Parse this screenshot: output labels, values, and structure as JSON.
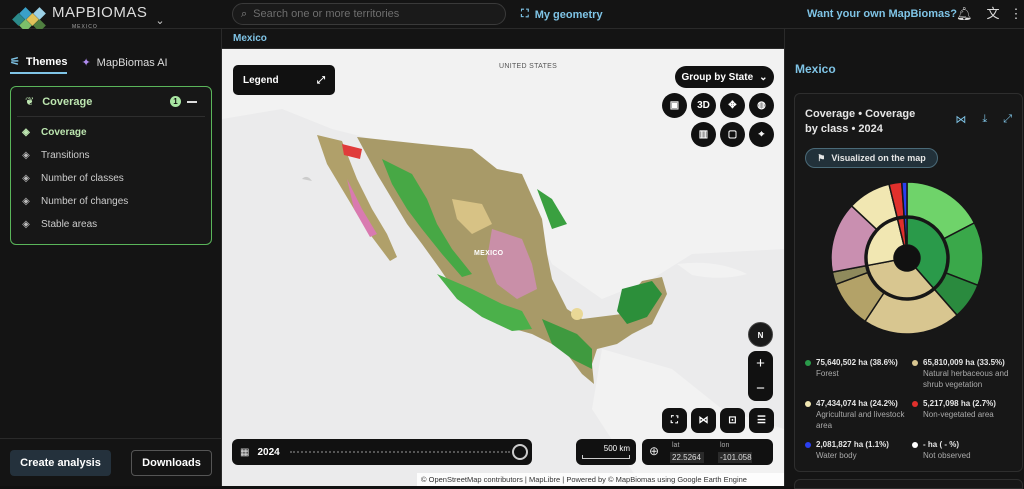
{
  "header": {
    "logo_text": "MAPBIOMAS",
    "logo_sub": "MEXICO",
    "search_placeholder": "Search one or more territories",
    "my_geometry": "My geometry",
    "want_own": "Want your own MapBiomas?"
  },
  "sidebar": {
    "tabs": [
      {
        "label": "Themes"
      },
      {
        "label": "MapBiomas AI"
      }
    ],
    "panel": {
      "title": "Coverage",
      "count": "1",
      "items": [
        {
          "label": "Coverage"
        },
        {
          "label": "Transitions"
        },
        {
          "label": "Number of classes"
        },
        {
          "label": "Number of changes"
        },
        {
          "label": "Stable areas"
        }
      ]
    },
    "create_label": "Create analysis",
    "downloads_label": "Downloads"
  },
  "breadcrumb": "Mexico",
  "map": {
    "legend_label": "Legend",
    "group_by": "Group by State",
    "label_3d": "3D",
    "label_north": "N",
    "label_us": "UNITED STATES",
    "label_mx": "MEXICO",
    "zoom_in": "+",
    "zoom_out": "−",
    "year": "2024",
    "scale": "500 km",
    "lat_label": "lat",
    "lon_label": "lon",
    "lat_value": "22.5264",
    "lon_value": "-101.0583",
    "attribution": "© OpenStreetMap contributors | MapLibre | Powered by © MapBiomas using Google Earth Engine"
  },
  "panel_right": {
    "title": "Mexico",
    "card_title": "Coverage • Coverage by class • 2024",
    "viz_label": "Visualized on the map",
    "legend": [
      {
        "value": "75,640,502 ha (38.6%)",
        "name": "Forest",
        "color": "#2a9a4a"
      },
      {
        "value": "65,810,009 ha (33.5%)",
        "name": "Natural herbaceous and shrub vegetation",
        "color": "#d8c690"
      },
      {
        "value": "47,434,074 ha (24.2%)",
        "name": "Agricultural and livestock area",
        "color": "#f1e7b2"
      },
      {
        "value": "5,217,098 ha (2.7%)",
        "name": "Non-vegetated area",
        "color": "#e0302c"
      },
      {
        "value": "2,081,827 ha (1.1%)",
        "name": "Water body",
        "color": "#2a3ff0"
      },
      {
        "value": "- ha ( - %)",
        "name": "Not observed",
        "color": "#ffffff"
      }
    ]
  },
  "chart_data": {
    "type": "pie",
    "categories": [
      "Forest",
      "Natural herbaceous and shrub vegetation",
      "Agricultural and livestock area",
      "Non-vegetated area",
      "Water body",
      "Not observed"
    ],
    "values": [
      38.6,
      33.5,
      24.2,
      2.7,
      1.1,
      0
    ],
    "unit": "%",
    "colors": [
      "#2a9a4a",
      "#d8c690",
      "#f1e7b2",
      "#e0302c",
      "#2a3ff0",
      "#ffffff"
    ],
    "title": "Coverage • Coverage by class • 2024"
  }
}
